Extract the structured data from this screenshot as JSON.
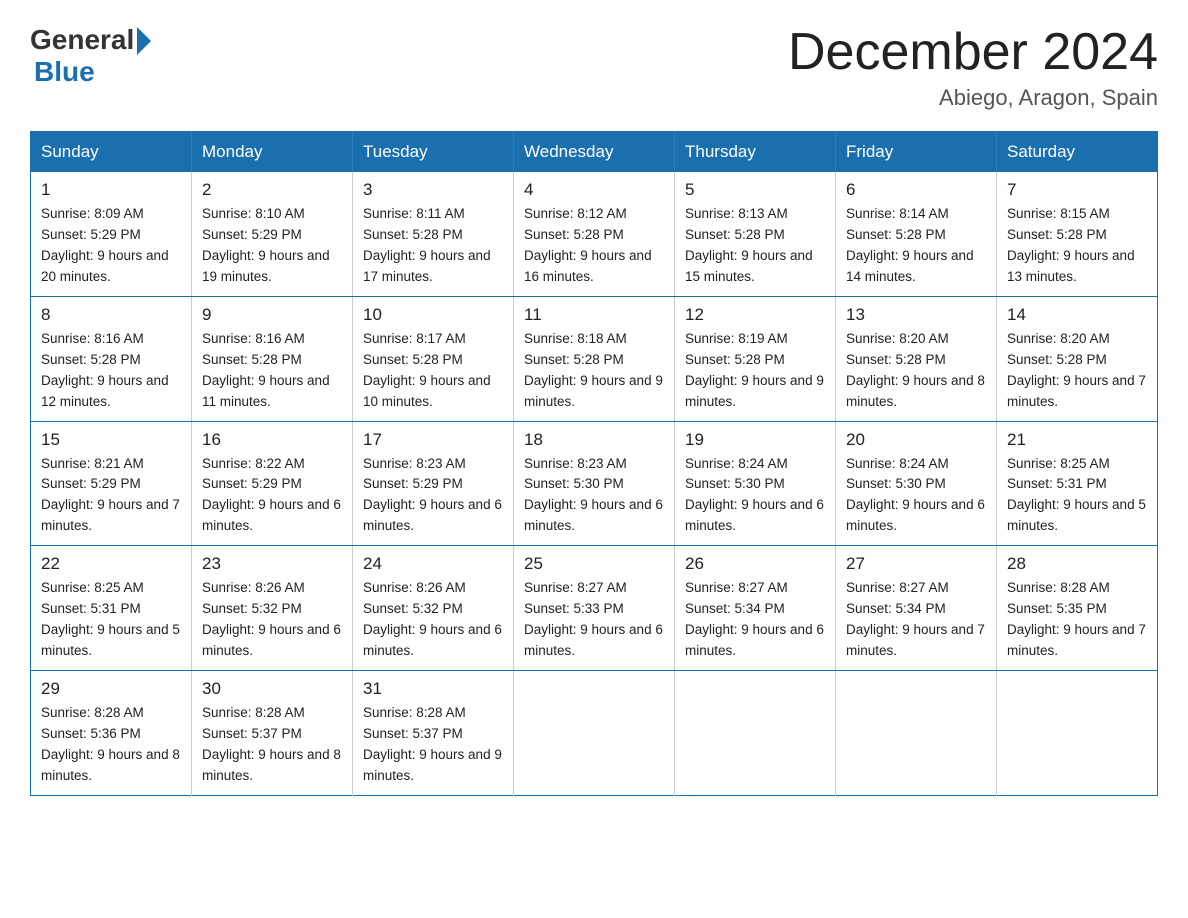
{
  "logo": {
    "general": "General",
    "blue": "Blue"
  },
  "title": "December 2024",
  "subtitle": "Abiego, Aragon, Spain",
  "headers": [
    "Sunday",
    "Monday",
    "Tuesday",
    "Wednesday",
    "Thursday",
    "Friday",
    "Saturday"
  ],
  "weeks": [
    [
      {
        "day": "1",
        "sunrise": "8:09 AM",
        "sunset": "5:29 PM",
        "daylight": "9 hours and 20 minutes."
      },
      {
        "day": "2",
        "sunrise": "8:10 AM",
        "sunset": "5:29 PM",
        "daylight": "9 hours and 19 minutes."
      },
      {
        "day": "3",
        "sunrise": "8:11 AM",
        "sunset": "5:28 PM",
        "daylight": "9 hours and 17 minutes."
      },
      {
        "day": "4",
        "sunrise": "8:12 AM",
        "sunset": "5:28 PM",
        "daylight": "9 hours and 16 minutes."
      },
      {
        "day": "5",
        "sunrise": "8:13 AM",
        "sunset": "5:28 PM",
        "daylight": "9 hours and 15 minutes."
      },
      {
        "day": "6",
        "sunrise": "8:14 AM",
        "sunset": "5:28 PM",
        "daylight": "9 hours and 14 minutes."
      },
      {
        "day": "7",
        "sunrise": "8:15 AM",
        "sunset": "5:28 PM",
        "daylight": "9 hours and 13 minutes."
      }
    ],
    [
      {
        "day": "8",
        "sunrise": "8:16 AM",
        "sunset": "5:28 PM",
        "daylight": "9 hours and 12 minutes."
      },
      {
        "day": "9",
        "sunrise": "8:16 AM",
        "sunset": "5:28 PM",
        "daylight": "9 hours and 11 minutes."
      },
      {
        "day": "10",
        "sunrise": "8:17 AM",
        "sunset": "5:28 PM",
        "daylight": "9 hours and 10 minutes."
      },
      {
        "day": "11",
        "sunrise": "8:18 AM",
        "sunset": "5:28 PM",
        "daylight": "9 hours and 9 minutes."
      },
      {
        "day": "12",
        "sunrise": "8:19 AM",
        "sunset": "5:28 PM",
        "daylight": "9 hours and 9 minutes."
      },
      {
        "day": "13",
        "sunrise": "8:20 AM",
        "sunset": "5:28 PM",
        "daylight": "9 hours and 8 minutes."
      },
      {
        "day": "14",
        "sunrise": "8:20 AM",
        "sunset": "5:28 PM",
        "daylight": "9 hours and 7 minutes."
      }
    ],
    [
      {
        "day": "15",
        "sunrise": "8:21 AM",
        "sunset": "5:29 PM",
        "daylight": "9 hours and 7 minutes."
      },
      {
        "day": "16",
        "sunrise": "8:22 AM",
        "sunset": "5:29 PM",
        "daylight": "9 hours and 6 minutes."
      },
      {
        "day": "17",
        "sunrise": "8:23 AM",
        "sunset": "5:29 PM",
        "daylight": "9 hours and 6 minutes."
      },
      {
        "day": "18",
        "sunrise": "8:23 AM",
        "sunset": "5:30 PM",
        "daylight": "9 hours and 6 minutes."
      },
      {
        "day": "19",
        "sunrise": "8:24 AM",
        "sunset": "5:30 PM",
        "daylight": "9 hours and 6 minutes."
      },
      {
        "day": "20",
        "sunrise": "8:24 AM",
        "sunset": "5:30 PM",
        "daylight": "9 hours and 6 minutes."
      },
      {
        "day": "21",
        "sunrise": "8:25 AM",
        "sunset": "5:31 PM",
        "daylight": "9 hours and 5 minutes."
      }
    ],
    [
      {
        "day": "22",
        "sunrise": "8:25 AM",
        "sunset": "5:31 PM",
        "daylight": "9 hours and 5 minutes."
      },
      {
        "day": "23",
        "sunrise": "8:26 AM",
        "sunset": "5:32 PM",
        "daylight": "9 hours and 6 minutes."
      },
      {
        "day": "24",
        "sunrise": "8:26 AM",
        "sunset": "5:32 PM",
        "daylight": "9 hours and 6 minutes."
      },
      {
        "day": "25",
        "sunrise": "8:27 AM",
        "sunset": "5:33 PM",
        "daylight": "9 hours and 6 minutes."
      },
      {
        "day": "26",
        "sunrise": "8:27 AM",
        "sunset": "5:34 PM",
        "daylight": "9 hours and 6 minutes."
      },
      {
        "day": "27",
        "sunrise": "8:27 AM",
        "sunset": "5:34 PM",
        "daylight": "9 hours and 7 minutes."
      },
      {
        "day": "28",
        "sunrise": "8:28 AM",
        "sunset": "5:35 PM",
        "daylight": "9 hours and 7 minutes."
      }
    ],
    [
      {
        "day": "29",
        "sunrise": "8:28 AM",
        "sunset": "5:36 PM",
        "daylight": "9 hours and 8 minutes."
      },
      {
        "day": "30",
        "sunrise": "8:28 AM",
        "sunset": "5:37 PM",
        "daylight": "9 hours and 8 minutes."
      },
      {
        "day": "31",
        "sunrise": "8:28 AM",
        "sunset": "5:37 PM",
        "daylight": "9 hours and 9 minutes."
      },
      null,
      null,
      null,
      null
    ]
  ]
}
